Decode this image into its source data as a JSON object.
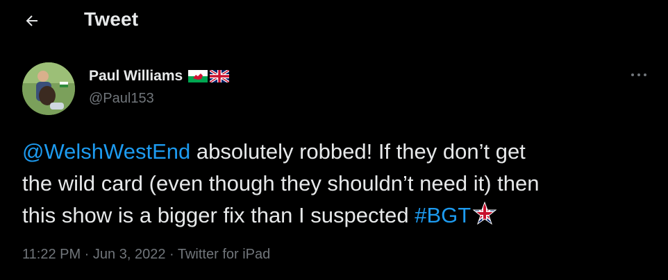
{
  "header": {
    "title": "Tweet",
    "back_icon": "arrow-left-icon"
  },
  "author": {
    "display_name": "Paul Williams",
    "handle": "@Paul153",
    "flags": [
      "wales-flag-icon",
      "uk-flag-icon"
    ]
  },
  "tweet": {
    "mention": "@WelshWestEnd",
    "line1_rest": " absolutely robbed! If they don’t get",
    "line2": "the wild card (even though they shouldn’t need it) then",
    "line3": "this show is a bigger fix than I suspected ",
    "hashtag": "#BGT",
    "hashtag_icon": "union-jack-star-icon"
  },
  "meta": {
    "time": "11:22 PM",
    "separator": " · ",
    "date": "Jun 3, 2022",
    "source": "Twitter for iPad"
  },
  "colors": {
    "background": "#000000",
    "text": "#e7e9ea",
    "muted": "#71767b",
    "accent": "#1d9bf0"
  }
}
